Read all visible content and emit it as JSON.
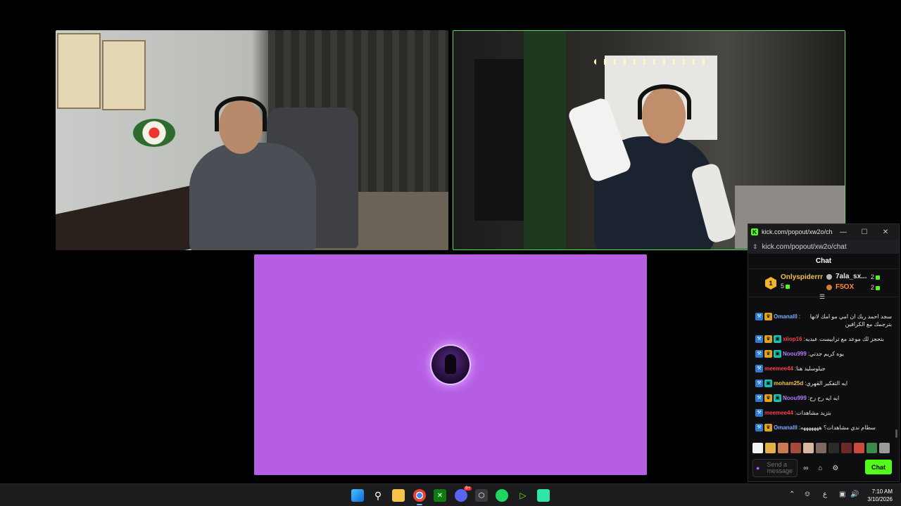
{
  "chat_window": {
    "title": "kick.com/popout/xw2o/chat...",
    "url": "kick.com/popout/xw2o/chat",
    "header": "Chat",
    "leaderboard": {
      "rank_badge": "1",
      "top_user": "Onlyspiderrr",
      "top_count": "5",
      "second_user": "7ala_sx...",
      "second_count": "2",
      "third_user": "F5OX",
      "third_count": "2"
    },
    "messages": [
      {
        "user": "Omanalll",
        "color": "#7fa9ff",
        "text": "سجد احمد ربك ان امي مو امك لانها بترجمك مع الكرافين",
        "badges": [
          "blue",
          "gold"
        ]
      },
      {
        "user": "xiiop16",
        "color": "#ff3b4a",
        "text": "بتحجز لك موعد مع ترابيست عبديه",
        "badges": [
          "blue",
          "gold",
          "teal"
        ]
      },
      {
        "user": "Noou999",
        "color": "#b37aff",
        "text": "يوه كريم جدتي",
        "badges": [
          "blue",
          "gold",
          "teal"
        ]
      },
      {
        "user": "meemee44",
        "color": "#ff3b4a",
        "text": "جيلوسليد هنا",
        "badges": [
          "blue"
        ]
      },
      {
        "user": "moham25d",
        "color": "#f0c04a",
        "text": "ايه التفكير القهري",
        "badges": [
          "blue",
          "teal"
        ]
      },
      {
        "user": "Noou999",
        "color": "#b37aff",
        "text": "ايه ايه رح رح",
        "badges": [
          "blue",
          "gold",
          "teal"
        ]
      },
      {
        "user": "meemee44",
        "color": "#ff3b4a",
        "text": "بتزيد مشاهدات",
        "badges": [
          "blue"
        ]
      },
      {
        "user": "Omanalll",
        "color": "#7fa9ff",
        "text": "سطام ندي مشاهدات؟ هههههههه",
        "badges": [
          "blue",
          "gold"
        ]
      }
    ],
    "input_placeholder": "Send a message",
    "send_label": "Chat"
  },
  "taskbar": {
    "time": "7:10 AM",
    "date": "3/10/2026",
    "lang": "ع",
    "discord_badge": "9+"
  },
  "colors": {
    "kick_green": "#53fc18",
    "stream_bg": "#b65ee3"
  }
}
